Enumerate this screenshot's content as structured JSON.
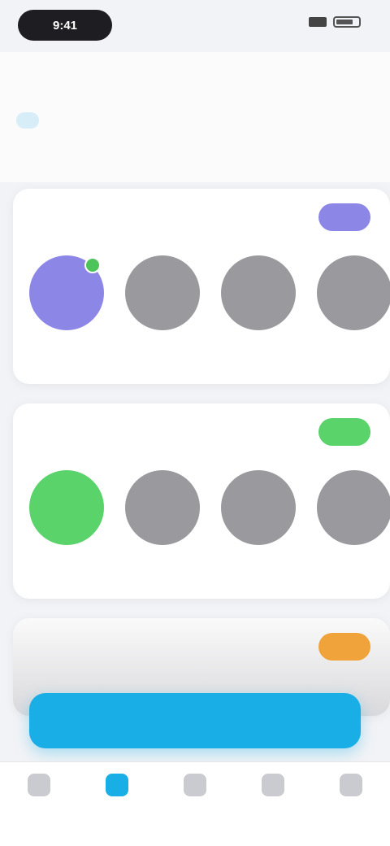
{
  "status": {
    "time": "9:41"
  },
  "header": {
    "title": "",
    "tabs": [
      {
        "label": ""
      },
      {
        "label": ""
      }
    ],
    "subline": ""
  },
  "cards": [
    {
      "title": "",
      "badge": "",
      "accent": "#8c87e6",
      "steps": [
        {
          "label": "",
          "state": "active"
        },
        {
          "label": "",
          "state": "locked"
        },
        {
          "label": "",
          "state": "locked"
        },
        {
          "label": "",
          "state": "locked"
        }
      ]
    },
    {
      "title": "",
      "badge": "",
      "accent": "#59d36a",
      "steps": [
        {
          "label": "",
          "state": "active"
        },
        {
          "label": "",
          "state": "locked"
        },
        {
          "label": "",
          "state": "locked"
        },
        {
          "label": "",
          "state": "locked"
        }
      ]
    },
    {
      "title": "",
      "badge": "",
      "accent": "#f0a33a"
    }
  ],
  "cta": {
    "label": ""
  },
  "tabbar": [
    {
      "label": "",
      "icon": "home-icon"
    },
    {
      "label": "",
      "icon": "learn-icon"
    },
    {
      "label": "",
      "icon": "practice-icon"
    },
    {
      "label": "",
      "icon": "profile-icon"
    },
    {
      "label": "",
      "icon": "more-icon"
    }
  ],
  "colors": {
    "primary": "#19aee6",
    "purple": "#8c87e6",
    "green": "#59d36a",
    "orange": "#f0a33a"
  }
}
